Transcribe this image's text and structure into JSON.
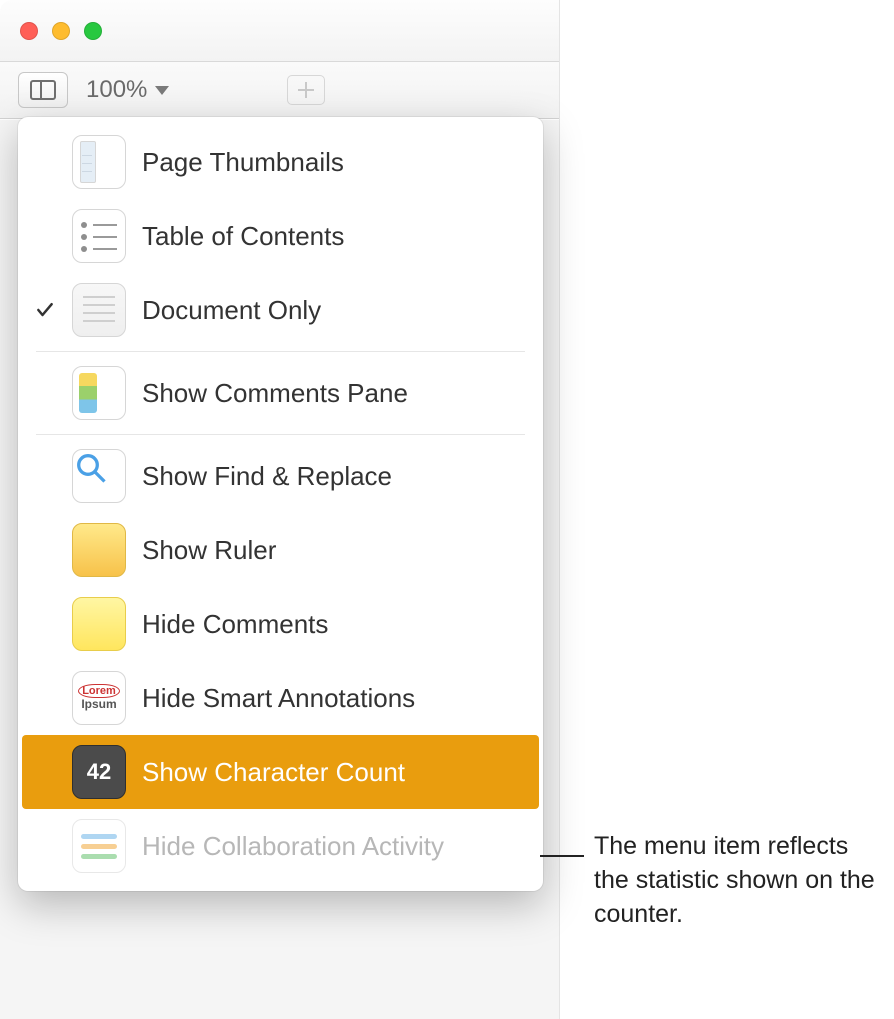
{
  "toolbar": {
    "zoom_value": "100%"
  },
  "menu": {
    "items": {
      "page_thumbnails": {
        "label": "Page Thumbnails"
      },
      "table_of_contents": {
        "label": "Table of Contents"
      },
      "document_only": {
        "label": "Document Only",
        "checked": true
      },
      "show_comments_pane": {
        "label": "Show Comments Pane"
      },
      "show_find_replace": {
        "label": "Show Find & Replace"
      },
      "show_ruler": {
        "label": "Show Ruler"
      },
      "hide_comments": {
        "label": "Hide Comments"
      },
      "hide_smart_annotations": {
        "label": "Hide Smart Annotations"
      },
      "show_character_count": {
        "label": "Show Character Count",
        "highlighted": true,
        "icon_value": "42"
      },
      "hide_collaboration_activity": {
        "label": "Hide Collaboration Activity",
        "disabled": true
      }
    },
    "lorem_line_1": "Lorem",
    "lorem_line_2": "Ipsum"
  },
  "callout": {
    "text": "The menu item reflects the statistic shown on the counter."
  }
}
